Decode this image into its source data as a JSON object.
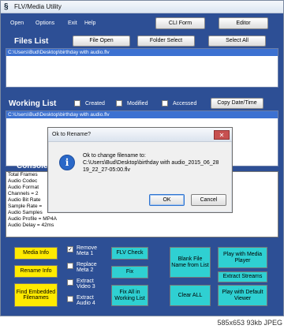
{
  "window": {
    "title": "FLV/Media Utility",
    "icon_glyph": "§"
  },
  "menu": {
    "items": [
      "Open",
      "Options",
      "Exit",
      "Help"
    ],
    "cli_button": "CLI Form",
    "editor_button": "Editor"
  },
  "files_list": {
    "label": "Files List",
    "buttons": {
      "file_open": "File Open",
      "folder_select": "Folder Select",
      "select_all": "Select All"
    },
    "selected_path": "C:\\Users\\Bud\\Desktop\\birthday with audio.flv"
  },
  "working_list": {
    "label": "Working List",
    "checkboxes": {
      "created": "Created",
      "modified": "Modified",
      "accessed": "Accessed"
    },
    "copy_button": "Copy Date/Time",
    "selected_path": "C:\\Users\\Bud\\Desktop\\birthday with audio.flv"
  },
  "console": {
    "label": "Console",
    "lines": [
      "Total Frames",
      "Audio Codec",
      "Audio Format",
      "Channels = 2",
      "Audio Bit Rate",
      "Sample Rate =",
      "Audio Samples",
      "Audio Profile = MP4A",
      "Audio Delay = 42ms"
    ]
  },
  "bottom": {
    "media_info": "Media Info",
    "rename_info": "Rename Info",
    "find_embedded": "Find Embedded Filenames",
    "remove_meta": "Remove Meta 1",
    "replace_meta": "Replace Meta 2",
    "extract_video": "Extract Video 3",
    "extract_audio": "Extract Audio 4",
    "check_mark": "✓",
    "flv_check": "FLV Check",
    "fix": "Fix",
    "fix_all": "Fix All in Working List",
    "blank_file": "Blank File Name from List",
    "clear_all": "Clear ALL",
    "play_media_player": "Play with Media Player",
    "extract_streams": "Extract Streams",
    "play_default_viewer": "Play with Default Viewer"
  },
  "dialog": {
    "title": "Ok to Rename?",
    "close_glyph": "✕",
    "info_glyph": "i",
    "message_lines": [
      "Ok to change filename to:",
      "C:\\Users\\Bud\\Desktop\\birthday with audio_2015_06_28",
      "19_22_27-05:00.flv"
    ],
    "ok": "OK",
    "cancel": "Cancel"
  },
  "caption": "585x653 93kb JPEG"
}
